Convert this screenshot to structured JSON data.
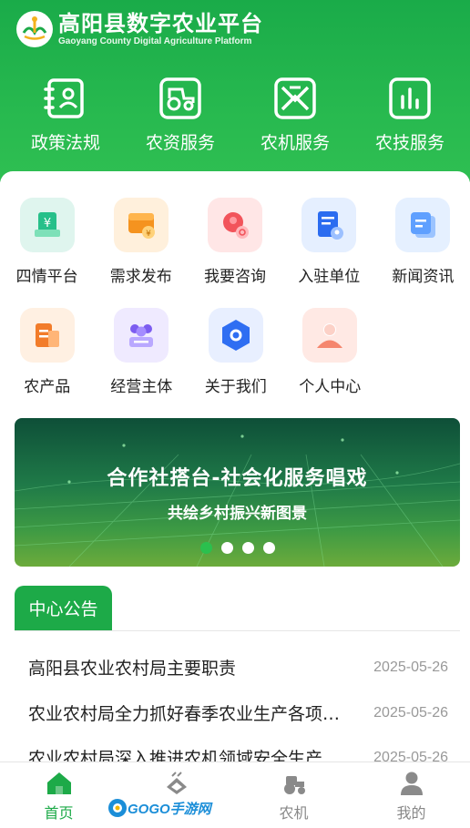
{
  "app": {
    "title": "高阳县数字农业平台",
    "subtitle": "Gaoyang County Digital Agriculture Platform"
  },
  "top_nav": [
    {
      "label": "政策法规",
      "icon": "policy-book-icon"
    },
    {
      "label": "农资服务",
      "icon": "tractor-icon"
    },
    {
      "label": "农机服务",
      "icon": "machine-icon"
    },
    {
      "label": "农技服务",
      "icon": "bar-chart-icon"
    }
  ],
  "grid": [
    {
      "label": "四情平台",
      "icon": "platform-icon",
      "bg": "#dff5ee"
    },
    {
      "label": "需求发布",
      "icon": "release-icon",
      "bg": "#fff0dc"
    },
    {
      "label": "我要咨询",
      "icon": "consult-icon",
      "bg": "#ffe6e6"
    },
    {
      "label": "入驻单位",
      "icon": "unit-icon",
      "bg": "#e5efff"
    },
    {
      "label": "新闻资讯",
      "icon": "news-icon",
      "bg": "#e5f0ff"
    },
    {
      "label": "农产品",
      "icon": "product-icon",
      "bg": "#fff0e2"
    },
    {
      "label": "经营主体",
      "icon": "entity-icon",
      "bg": "#efeaff"
    },
    {
      "label": "关于我们",
      "icon": "about-icon",
      "bg": "#e8efff"
    },
    {
      "label": "个人中心",
      "icon": "person-icon",
      "bg": "#ffe9e4"
    }
  ],
  "banner": {
    "headline": "合作社搭台-社会化服务唱戏",
    "subline": "共绘乡村振兴新图景",
    "slide_count": 4,
    "active_slide": 1
  },
  "notice": {
    "tab_label": "中心公告",
    "items": [
      {
        "title": "高阳县农业农村局主要职责",
        "date": "2025-05-26"
      },
      {
        "title": "农业农村局全力抓好春季农业生产各项工作",
        "date": "2025-05-26"
      },
      {
        "title": "农业农村局深入推进农机领域安全生产",
        "date": "2025-05-26"
      }
    ]
  },
  "tabbar": [
    {
      "label": "首页",
      "icon": "home-icon",
      "active": true
    },
    {
      "label": "",
      "icon": "crop-icon",
      "active": false
    },
    {
      "label": "农机",
      "icon": "tractor-tab-icon",
      "active": false
    },
    {
      "label": "我的",
      "icon": "user-icon",
      "active": false
    }
  ],
  "watermark": {
    "text": "GOGO手游网"
  },
  "colors": {
    "primary": "#1daa48",
    "muted": "#888888"
  }
}
